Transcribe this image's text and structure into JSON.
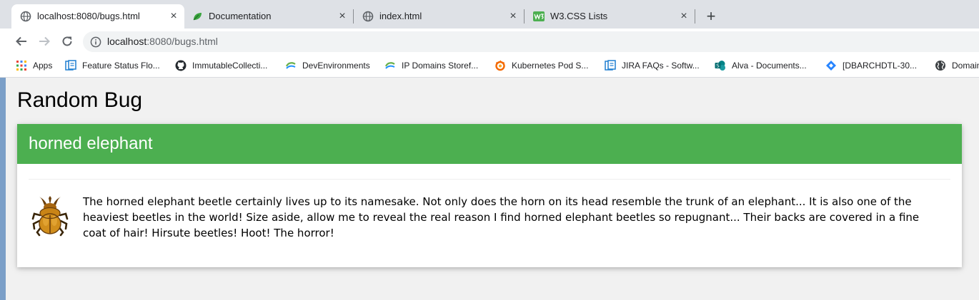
{
  "browser": {
    "tabs": [
      {
        "title": "localhost:8080/bugs.html",
        "icon": "globe-icon",
        "active": true
      },
      {
        "title": "Documentation",
        "icon": "leaf-icon",
        "active": false
      },
      {
        "title": "index.html",
        "icon": "globe-icon",
        "active": false
      },
      {
        "title": "W3.CSS Lists",
        "icon": "w3-icon",
        "active": false
      }
    ],
    "new_tab_label": "+",
    "close_label": "×",
    "url_host": "localhost",
    "url_rest": ":8080/bugs.html",
    "bookmarks": [
      {
        "label": "Apps",
        "icon": "apps-grid-icon"
      },
      {
        "label": "Feature Status Flo...",
        "icon": "doc-icon"
      },
      {
        "label": "ImmutableCollecti...",
        "icon": "github-icon"
      },
      {
        "label": "DevEnvironments",
        "icon": "swirl-icon"
      },
      {
        "label": "IP Domains Storef...",
        "icon": "swirl-icon"
      },
      {
        "label": "Kubernetes Pod S...",
        "icon": "grafana-icon"
      },
      {
        "label": "JIRA FAQs - Softw...",
        "icon": "doc-icon"
      },
      {
        "label": "Alva - Documents...",
        "icon": "sharepoint-icon"
      },
      {
        "label": "[DBARCHDTL-30...",
        "icon": "jira-icon"
      },
      {
        "label": "Domain",
        "icon": "globe-icon"
      }
    ]
  },
  "page": {
    "title": "Random Bug",
    "card": {
      "heading": "horned elephant",
      "image": "beetle-icon",
      "description": "The horned elephant beetle certainly lives up to its namesake. Not only does the horn on its head resemble the trunk of an elephant... It is also one of the heaviest beetles in the world! Size aside, allow me to reveal the real reason I find horned elephant beetles so repugnant... Their backs are covered in a fine coat of hair! Hirsute beetles! Hoot! The horror!"
    }
  },
  "colors": {
    "card_header": "#4caf50",
    "page_background": "#f1f1f1",
    "tabstrip": "#dee1e6"
  }
}
